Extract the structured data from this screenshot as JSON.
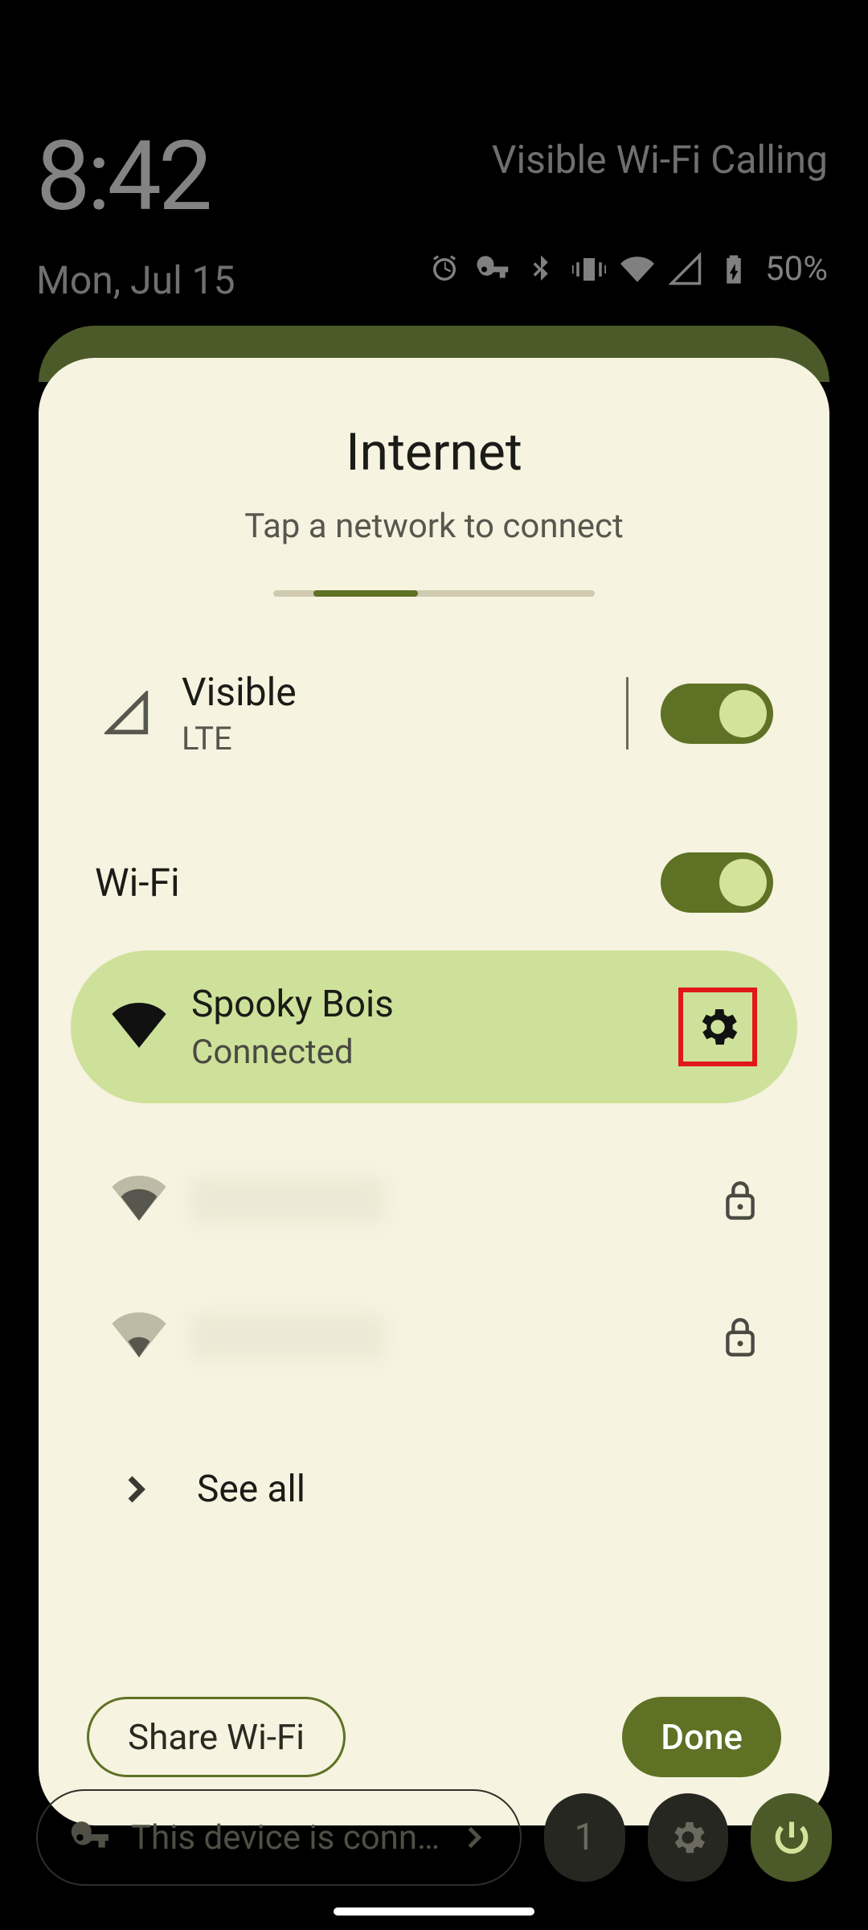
{
  "statusbar": {
    "time": "8:42",
    "date": "Mon, Jul 15",
    "carrier_feature": "Visible Wi-Fi Calling",
    "battery_pct": "50%"
  },
  "dialog": {
    "title": "Internet",
    "subtitle": "Tap a network to connect",
    "mobile": {
      "name": "Visible",
      "tech": "LTE",
      "enabled": true
    },
    "wifi_label": "Wi-Fi",
    "wifi_enabled": true,
    "connected_network": {
      "ssid": "Spooky Bois",
      "status": "Connected"
    },
    "see_all_label": "See all",
    "share_label": "Share Wi-Fi",
    "done_label": "Done"
  },
  "bottombar": {
    "vpn_text": "This device is conn…",
    "page_indicator": "1"
  },
  "highlight": {
    "color": "#e01818"
  }
}
